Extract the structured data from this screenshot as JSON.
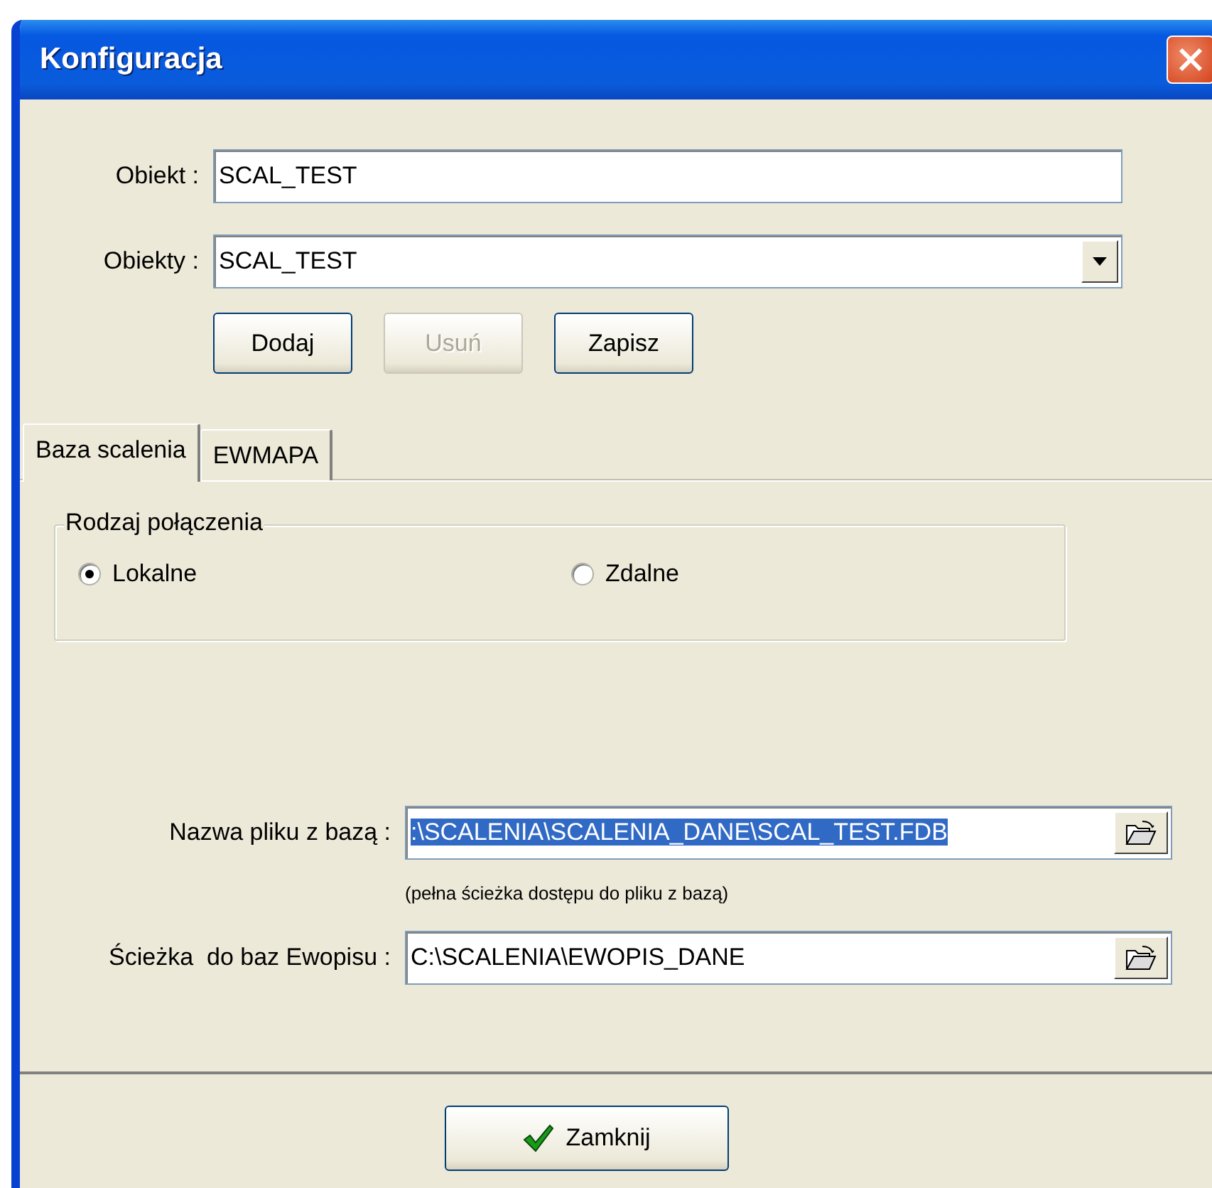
{
  "window": {
    "title": "Konfiguracja"
  },
  "fields": [
    {
      "kind": "text",
      "label": "Obiekt :",
      "value": "SCAL_TEST"
    },
    {
      "kind": "combo",
      "label": "Obiekty :",
      "value": "SCAL_TEST"
    }
  ],
  "buttons": [
    {
      "label": "Dodaj",
      "disabled": false
    },
    {
      "label": "Usuń",
      "disabled": true
    },
    {
      "label": "Zapisz",
      "disabled": false
    }
  ],
  "tabs": [
    {
      "label": "Baza scalenia",
      "selected": true
    },
    {
      "label": "EWMAPA",
      "selected": false
    }
  ],
  "connection": {
    "legend": "Rodzaj połączenia",
    "options": [
      {
        "label": "Lokalne",
        "selected": true
      },
      {
        "label": "Zdalne",
        "selected": false
      }
    ]
  },
  "database_file": {
    "label": "Nazwa pliku z bazą :",
    "value": ":\\SCALENIA\\SCALENIA_DANE\\SCAL_TEST.FDB",
    "text_selected": true,
    "hint": "(pełna ścieżka dostępu do pliku z bazą)"
  },
  "ewopis_path": {
    "label": "Ścieżka  do baz Ewopisu :",
    "value": "C:\\SCALENIA\\EWOPIS_DANE",
    "text_selected": false
  },
  "close_button": {
    "label": "Zamknij"
  }
}
